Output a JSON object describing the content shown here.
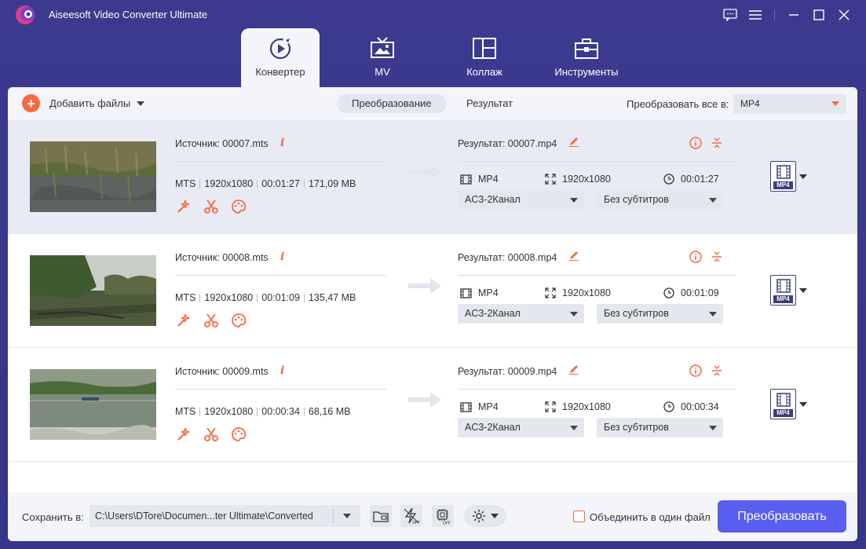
{
  "app": {
    "title": "Aiseesoft Video Converter Ultimate"
  },
  "tabs": [
    {
      "label": "Конвертер",
      "icon": "converter-icon",
      "active": true
    },
    {
      "label": "MV",
      "icon": "tv-icon",
      "active": false
    },
    {
      "label": "Коллаж",
      "icon": "collage-icon",
      "active": false
    },
    {
      "label": "Инструменты",
      "icon": "toolbox-icon",
      "active": false
    }
  ],
  "toolbar": {
    "add_files_label": "Добавить файлы",
    "subtabs": [
      "Преобразование",
      "Результат"
    ],
    "convert_all_label": "Преобразовать все в:",
    "convert_all_value": "MP4"
  },
  "files": [
    {
      "source": "Источник: 00007.mts",
      "src_format": "MTS",
      "src_resolution": "1920x1080",
      "src_duration": "00:01:27",
      "src_size": "171,09 MB",
      "result": "Результат: 00007.mp4",
      "out_format": "MP4",
      "out_resolution": "1920x1080",
      "out_duration": "00:01:27",
      "audio": "AC3-2Канал",
      "subtitles": "Без субтитров",
      "format_badge": "MP4"
    },
    {
      "source": "Источник: 00008.mts",
      "src_format": "MTS",
      "src_resolution": "1920x1080",
      "src_duration": "00:01:09",
      "src_size": "135,47 MB",
      "result": "Результат: 00008.mp4",
      "out_format": "MP4",
      "out_resolution": "1920x1080",
      "out_duration": "00:01:09",
      "audio": "AC3-2Канал",
      "subtitles": "Без субтитров",
      "format_badge": "MP4"
    },
    {
      "source": "Источник: 00009.mts",
      "src_format": "MTS",
      "src_resolution": "1920x1080",
      "src_duration": "00:00:34",
      "src_size": "68,16 MB",
      "result": "Результат: 00009.mp4",
      "out_format": "MP4",
      "out_resolution": "1920x1080",
      "out_duration": "00:00:34",
      "audio": "AC3-2Канал",
      "subtitles": "Без субтитров",
      "format_badge": "MP4"
    }
  ],
  "info_glyph": "i",
  "bottom": {
    "save_label": "Сохранить в:",
    "path": "C:\\Users\\DTore\\Documen...ter Ultimate\\Converted",
    "merge_label": "Объединить в один файл",
    "convert_button": "Преобразовать"
  },
  "colors": {
    "accent": "#f56a3f",
    "primary": "#5a5ef0",
    "header": "#3b3a8e"
  }
}
